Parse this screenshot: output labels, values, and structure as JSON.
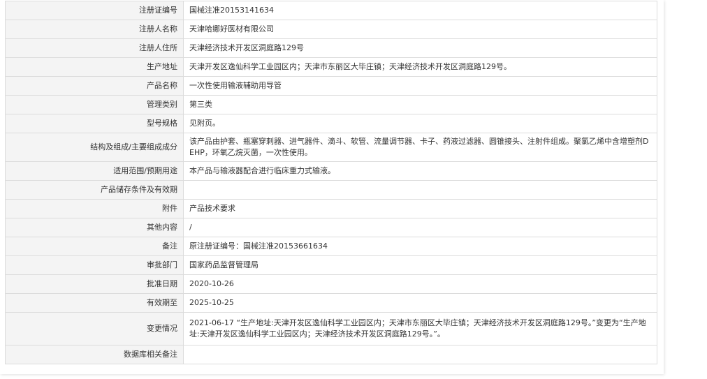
{
  "rows": [
    {
      "label": "注册证编号",
      "value": "国械注准20153141634"
    },
    {
      "label": "注册人名称",
      "value": "天津哈娜好医材有限公司"
    },
    {
      "label": "注册人住所",
      "value": "天津经济技术开发区洞庭路129号"
    },
    {
      "label": "生产地址",
      "value": "天津开发区逸仙科学工业园区内；天津市东丽区大毕庄镇；天津经济技术开发区洞庭路129号。"
    },
    {
      "label": "产品名称",
      "value": "一次性使用输液辅助用导管"
    },
    {
      "label": "管理类别",
      "value": "第三类"
    },
    {
      "label": "型号规格",
      "value": "见附页。"
    },
    {
      "label": "结构及组成/主要组成成分",
      "value": "该产品由护套、瓶塞穿刺器、进气器件、滴斗、软管、流量调节器、卡子、药液过滤器、圆锥接头、注射件组成。聚氯乙烯中含增塑剂DEHP，环氧乙烷灭菌，一次性使用。"
    },
    {
      "label": "适用范围/预期用途",
      "value": "本产品与输液器配合进行临床重力式输液。"
    },
    {
      "label": "产品储存条件及有效期",
      "value": ""
    },
    {
      "label": "附件",
      "value": "产品技术要求"
    },
    {
      "label": "其他内容",
      "value": "/"
    },
    {
      "label": "备注",
      "value": "原注册证编号：国械注准20153661634"
    },
    {
      "label": "审批部门",
      "value": "国家药品监督管理局"
    },
    {
      "label": "批准日期",
      "value": "2020-10-26"
    },
    {
      "label": "有效期至",
      "value": "2025-10-25"
    },
    {
      "label": "变更情况",
      "value": "2021-06-17 “生产地址:天津开发区逸仙科学工业园区内；天津市东丽区大毕庄镇；天津经济技术开发区洞庭路129号。”变更为“生产地址:天津开发区逸仙科学工业园区内；天津经济技术开发区洞庭路129号。”。"
    },
    {
      "label": "数据库相关备注",
      "value": ""
    }
  ]
}
